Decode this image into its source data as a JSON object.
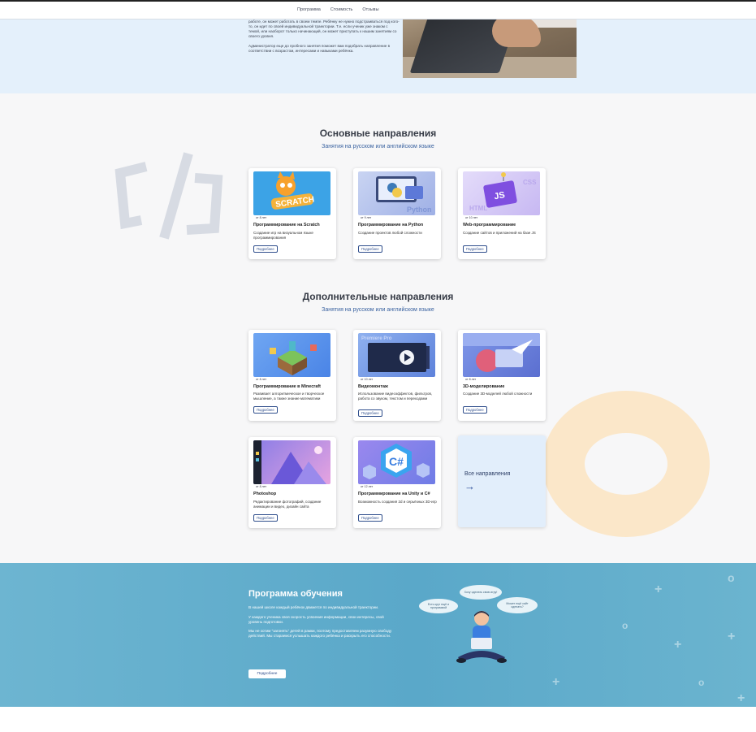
{
  "nav": {
    "items": [
      "Программа",
      "Стоимость",
      "Отзывы"
    ]
  },
  "hero": {
    "paragraphs": [
      "работе, он может работать в своем темпе. Ребёнку не нужно подстраиваться под кого-то, он идет по своей индивидуальной траектории. Т.е. если ученик уже знаком с темой, или наоборот только начинающий, он может приступать к нашим занятиям со своего уровня.",
      "Администратор еще до пробного занятия поможет вам подобрать направление в соответствии с возрастом, интересами и навыками ребёнка."
    ]
  },
  "main_section": {
    "title": "Основные направления",
    "subtitle": "Занятия на русском или английском языке",
    "cards": [
      {
        "age": "от 8 лет",
        "title": "Программирование на Scratch",
        "desc": "Создание игр на визуальном языке программирования",
        "button": "Подробнее"
      },
      {
        "age": "от 9 лет",
        "title": "Программирование на Python",
        "desc": "Создание проектов любой сложности",
        "button": "Подробнее"
      },
      {
        "age": "от 10 лет",
        "title": "Web-программирование",
        "desc": "Создание сайтов и приложений на базе JS",
        "button": "Подробнее"
      }
    ]
  },
  "extra_section": {
    "title": "Дополнительные направления",
    "subtitle": "Занятия на русском или английском языке",
    "cards": [
      {
        "age": "от 8 лет",
        "title": "Программирование в Minecraft",
        "desc": "Развивает алгоритмическое и творческое мышление, а также знание математики",
        "button": "Подробнее"
      },
      {
        "age": "от 10 лет",
        "title": "Видеомонтаж",
        "desc": "Использование видеоэффектов, фильтров, работа со звуком, текстом и переходами",
        "button": "Подробнее"
      },
      {
        "age": "от 8 лет",
        "title": "3D-моделирование",
        "desc": "Создание 3D-моделей любой сложности",
        "button": "Подробнее"
      },
      {
        "age": "от 8 лет",
        "title": "Photoshop",
        "desc": "Редактирование фотографий, создание анимации и видео, дизайн сайта",
        "button": "Подробнее"
      },
      {
        "age": "от 12 лет",
        "title": "Программирование на Unity и C#",
        "desc": "Возможность создания 2d и серьёзных 3D-игр",
        "button": "Подробнее"
      }
    ],
    "all_label": "Все направления",
    "all_arrow": "→"
  },
  "program": {
    "title": "Программа обучения",
    "paragraphs": [
      "В нашей школе каждый ребёнок движется по индивидуальной траектории.",
      "У каждого ученика своя скорость усвоения информации, свои интересы, свой уровень подготовки.",
      "Мы не хотим \"загонять\" детей в рамки, поэтому предоставляем разумную свободу действий. Мы стараемся услышать каждого ребёнка и раскрыть его способности."
    ],
    "button": "Подробнее",
    "bubbles": [
      "Хочу сделать свою игру!",
      "Есть круг ещё и программой",
      "Может ещё сайт сделать?"
    ]
  },
  "colors": {
    "accent": "#2f4e8c",
    "hero_bg": "#e4f0fb",
    "program_bg": "#5aa8c9",
    "ring": "#fbe7c9"
  }
}
